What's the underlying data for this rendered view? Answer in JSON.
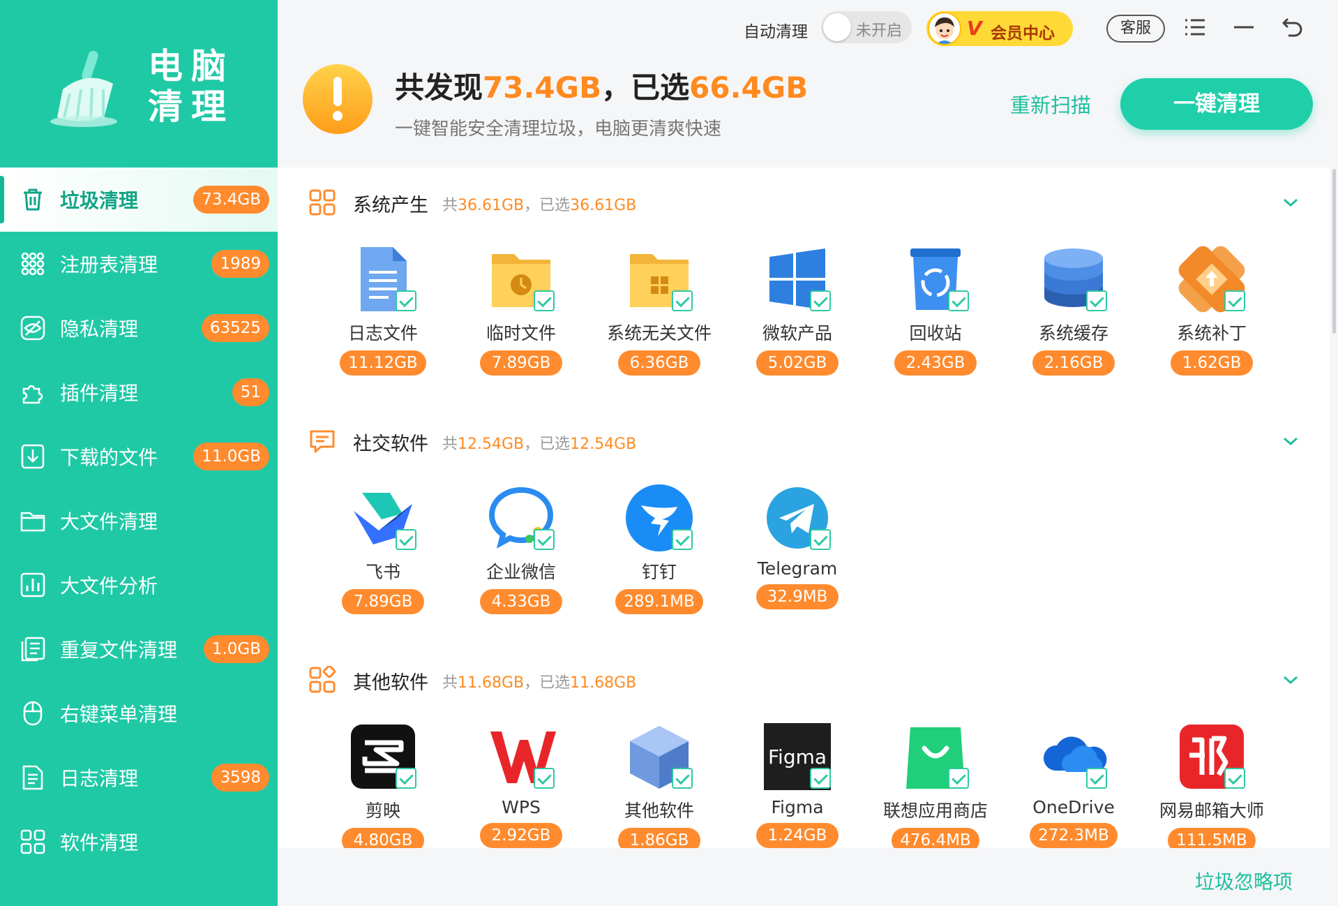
{
  "app": {
    "logo_line1": "电脑",
    "logo_line2": "清理"
  },
  "sidebar": {
    "items": [
      {
        "label": "垃圾清理",
        "badge": "73.4GB",
        "active": true
      },
      {
        "label": "注册表清理",
        "badge": "1989"
      },
      {
        "label": "隐私清理",
        "badge": "63525"
      },
      {
        "label": "插件清理",
        "badge": "51"
      },
      {
        "label": "下载的文件",
        "badge": "11.0GB"
      },
      {
        "label": "大文件清理",
        "badge": ""
      },
      {
        "label": "大文件分析",
        "badge": ""
      },
      {
        "label": "重复文件清理",
        "badge": "1.0GB"
      },
      {
        "label": "右键菜单清理",
        "badge": ""
      },
      {
        "label": "日志清理",
        "badge": "3598"
      },
      {
        "label": "软件清理",
        "badge": ""
      }
    ]
  },
  "topbar": {
    "auto_clean_label": "自动清理",
    "toggle_state": "未开启",
    "vip_label": "会员中心",
    "vip_letter": "V",
    "service_label": "客服"
  },
  "summary": {
    "found_prefix": "共发现",
    "found_value": "73.4GB",
    "selected_prefix": "，已选",
    "selected_value": "66.4GB",
    "subtitle": "一键智能安全清理垃圾，电脑更清爽快速",
    "rescan_label": "重新扫描",
    "clean_button_label": "一键清理"
  },
  "sections": [
    {
      "title": "系统产生",
      "total_prefix": "共",
      "total": "36.61GB",
      "selected_prefix": "，已选",
      "selected": "36.61GB",
      "items": [
        {
          "name": "日志文件",
          "size": "11.12GB",
          "icon": "log-file-icon"
        },
        {
          "name": "临时文件",
          "size": "7.89GB",
          "icon": "temp-folder-icon"
        },
        {
          "name": "系统无关文件",
          "size": "6.36GB",
          "icon": "system-folder-icon"
        },
        {
          "name": "微软产品",
          "size": "5.02GB",
          "icon": "windows-icon"
        },
        {
          "name": "回收站",
          "size": "2.43GB",
          "icon": "recycle-bin-icon"
        },
        {
          "name": "系统缓存",
          "size": "2.16GB",
          "icon": "database-icon"
        },
        {
          "name": "系统补丁",
          "size": "1.62GB",
          "icon": "patch-icon"
        }
      ]
    },
    {
      "title": "社交软件",
      "total_prefix": "共",
      "total": "12.54GB",
      "selected_prefix": "，已选",
      "selected": "12.54GB",
      "items": [
        {
          "name": "飞书",
          "size": "7.89GB",
          "icon": "feishu-icon"
        },
        {
          "name": "企业微信",
          "size": "4.33GB",
          "icon": "wecom-icon"
        },
        {
          "name": "钉钉",
          "size": "289.1MB",
          "icon": "dingtalk-icon"
        },
        {
          "name": "Telegram",
          "size": "32.9MB",
          "icon": "telegram-icon"
        }
      ]
    },
    {
      "title": "其他软件",
      "total_prefix": "共",
      "total": "11.68GB",
      "selected_prefix": "，已选",
      "selected": "11.68GB",
      "items": [
        {
          "name": "剪映",
          "size": "4.80GB",
          "icon": "capcut-icon"
        },
        {
          "name": "WPS",
          "size": "2.92GB",
          "icon": "wps-icon"
        },
        {
          "name": "其他软件",
          "size": "1.86GB",
          "icon": "cube-icon"
        },
        {
          "name": "Figma",
          "size": "1.24GB",
          "icon": "figma-icon",
          "icon_text": "Figma"
        },
        {
          "name": "联想应用商店",
          "size": "476.4MB",
          "icon": "lenovo-store-icon"
        },
        {
          "name": "OneDrive",
          "size": "272.3MB",
          "icon": "onedrive-icon"
        },
        {
          "name": "网易邮箱大师",
          "size": "111.5MB",
          "icon": "netease-mail-icon"
        }
      ]
    }
  ],
  "footer": {
    "ignore_label": "垃圾忽略项"
  },
  "colors": {
    "brand": "#1fc9a6",
    "accent_orange": "#ff8b2e",
    "link_green": "#1fbf9e"
  }
}
